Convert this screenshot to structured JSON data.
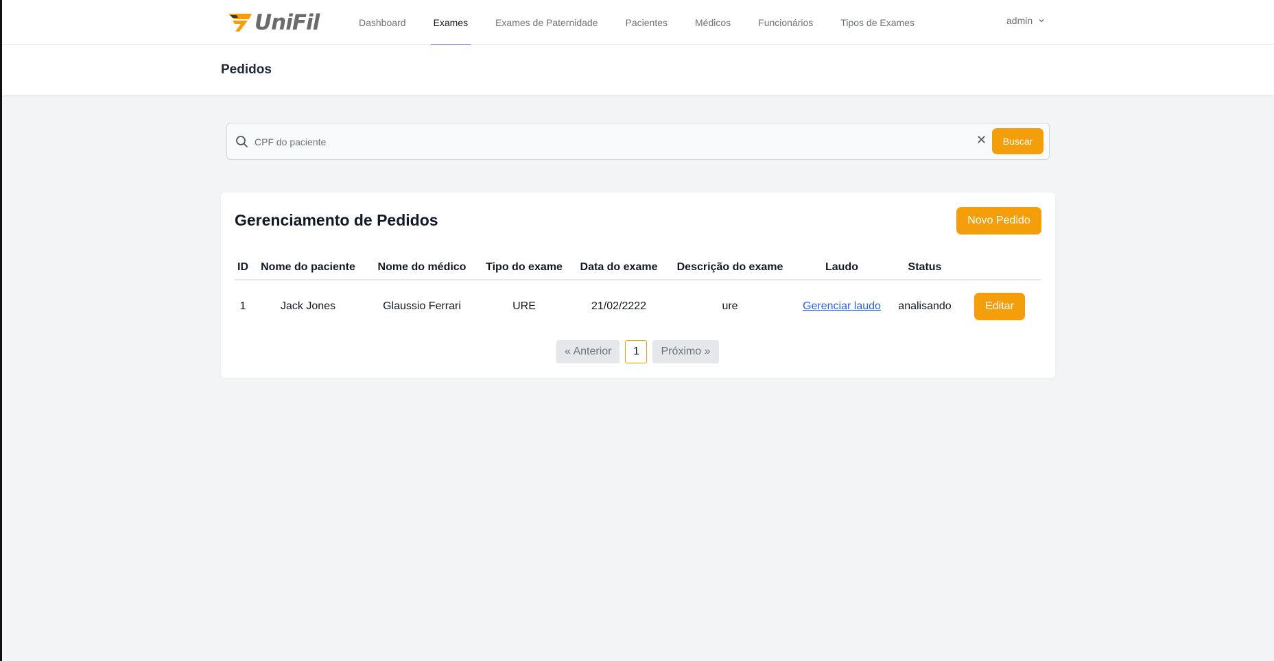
{
  "brand": {
    "name": "UniFil",
    "primary_color": "#f59e0b",
    "accent_color": "#6366f1"
  },
  "nav": {
    "items": [
      {
        "label": "Dashboard",
        "active": false
      },
      {
        "label": "Exames",
        "active": true
      },
      {
        "label": "Exames de Paternidade",
        "active": false
      },
      {
        "label": "Pacientes",
        "active": false
      },
      {
        "label": "Médicos",
        "active": false
      },
      {
        "label": "Funcionários",
        "active": false
      },
      {
        "label": "Tipos de Exames",
        "active": false
      }
    ],
    "user": "admin"
  },
  "page": {
    "title": "Pedidos"
  },
  "search": {
    "placeholder": "CPF do paciente",
    "value": "",
    "button_label": "Buscar"
  },
  "card": {
    "title": "Gerenciamento de Pedidos",
    "new_button": "Novo Pedido",
    "columns": [
      "ID",
      "Nome do paciente",
      "Nome do médico",
      "Tipo do exame",
      "Data do exame",
      "Descrição do exame",
      "Laudo",
      "Status"
    ],
    "rows": [
      {
        "id": "1",
        "paciente": "Jack Jones",
        "medico": "Glaussio Ferrari",
        "tipo": "URE",
        "data": "21/02/2222",
        "descricao": "ure",
        "laudo": "Gerenciar laudo",
        "status": "analisando",
        "action": "Editar"
      }
    ]
  },
  "pagination": {
    "prev": "« Anterior",
    "current": "1",
    "next": "Próximo »"
  }
}
